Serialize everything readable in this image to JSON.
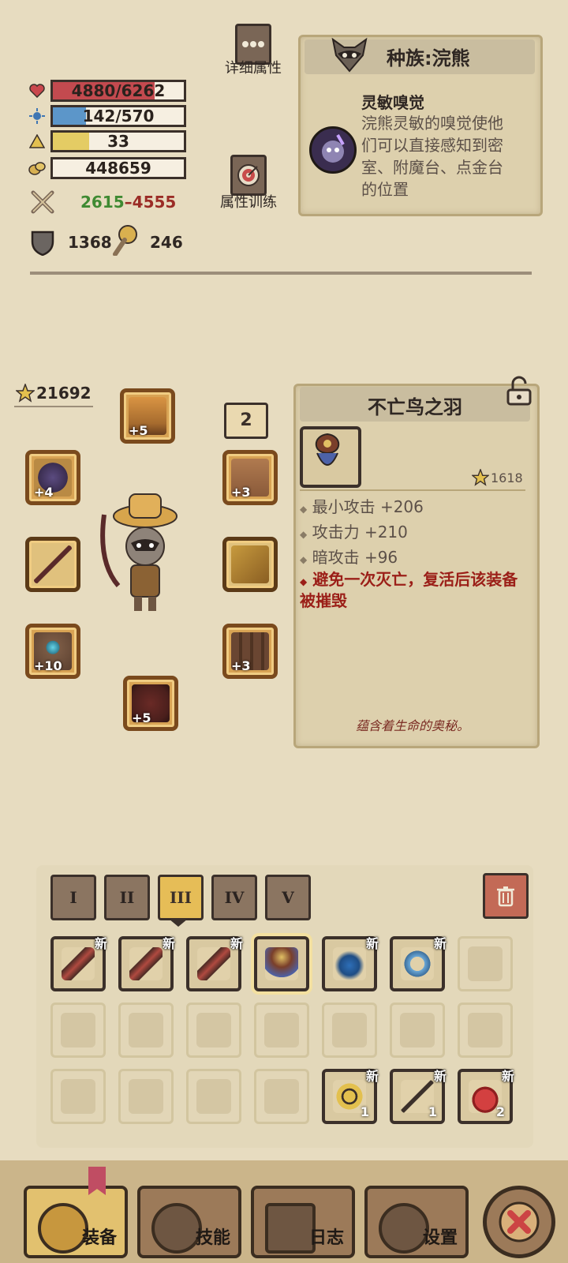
{
  "header": {
    "detail_attrs_label": "详细属性",
    "attr_training_label": "属性训练"
  },
  "stats": {
    "hp": {
      "text": "4880/6262",
      "fraction": 0.78,
      "color": "#c34a4f",
      "icon": "heart-icon"
    },
    "mp": {
      "text": "142/570",
      "fraction": 0.25,
      "color": "#5c96c9",
      "icon": "mana-icon"
    },
    "level": {
      "text": "33",
      "fraction": 0.28,
      "color": "#e4cc64",
      "icon": "level-icon"
    },
    "gold": {
      "text": "448659",
      "icon": "gold-icon"
    },
    "attack_min": "2615",
    "attack_dash": "–",
    "attack_max": "4555",
    "defense": "1368",
    "luck": "246"
  },
  "race": {
    "title": "种族:浣熊",
    "trait_title": "灵敏嗅觉",
    "trait_desc": "浣熊灵敏的嗅觉使他们可以直接感知到密室、附魔台、点金台的位置"
  },
  "equipment": {
    "power": "21692",
    "slot_count_badge": "2",
    "slots": [
      {
        "name": "hat",
        "plus": "+5"
      },
      {
        "name": "bow",
        "plus": "+4"
      },
      {
        "name": "sword",
        "plus": ""
      },
      {
        "name": "bracer",
        "plus": "+10"
      },
      {
        "name": "armor",
        "plus": "+5"
      },
      {
        "name": "shoulder",
        "plus": "+3"
      },
      {
        "name": "chest",
        "plus": ""
      },
      {
        "name": "barrel",
        "plus": "+3"
      }
    ]
  },
  "item_detail": {
    "title": "不亡鸟之羽",
    "power": "1618",
    "stats": [
      "最小攻击 +206",
      "攻击力 +210",
      "暗攻击 +96"
    ],
    "special": "避免一次灭亡，复活后该装备被摧毁",
    "flavor": "蕴含着生命的奥秘。"
  },
  "inventory": {
    "tabs": [
      "I",
      "II",
      "III",
      "IV",
      "V"
    ],
    "active_tab": "III",
    "new_label": "新",
    "counts": [
      "1",
      "1",
      "2"
    ]
  },
  "nav": {
    "equip": "装备",
    "skills": "技能",
    "log": "日志",
    "settings": "设置"
  },
  "colors": {
    "attack_min": "#3f8a32",
    "attack_max": "#9b2c26",
    "special_text": "#9b1f18"
  }
}
